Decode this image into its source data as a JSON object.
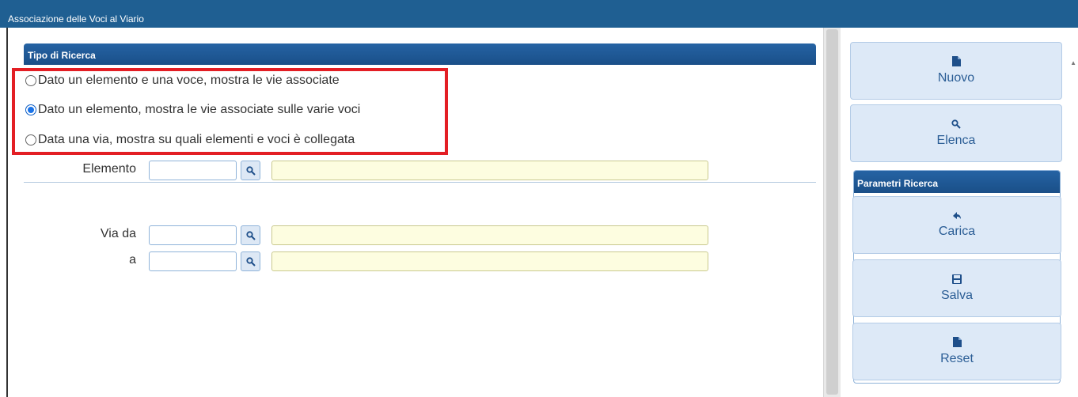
{
  "window": {
    "title": "Associazione delle Voci al Viario"
  },
  "tipo_ricerca": {
    "header": "Tipo di Ricerca",
    "options": [
      {
        "label": "Dato un elemento e una voce, mostra le vie associate",
        "checked": false
      },
      {
        "label": "Dato un elemento, mostra le vie associate sulle varie voci",
        "checked": true
      },
      {
        "label": "Data una via, mostra su quali elementi e voci è collegata",
        "checked": false
      }
    ]
  },
  "form": {
    "elemento_label": "Elemento",
    "elemento_code": "",
    "elemento_desc": "",
    "via_da_label": "Via da",
    "via_da_code": "",
    "via_da_desc": "",
    "a_label": "a",
    "a_code": "",
    "a_desc": ""
  },
  "actions": {
    "nuovo_label": "Nuovo",
    "elenca_label": "Elenca",
    "params_header": "Parametri Ricerca",
    "carica_label": "Carica",
    "salva_label": "Salva",
    "reset_label": "Reset"
  },
  "icons": {
    "nuovo": "document-icon",
    "elenca": "search-icon",
    "carica": "undo-arrow-icon",
    "salva": "floppy-disk-icon",
    "reset": "document-icon"
  },
  "colors": {
    "titlebar": "#1f5f92",
    "header": "#1f5d9c",
    "highlight": "#e31e24",
    "button_bg": "#dde9f7",
    "desc_bg": "#fdfde0"
  }
}
